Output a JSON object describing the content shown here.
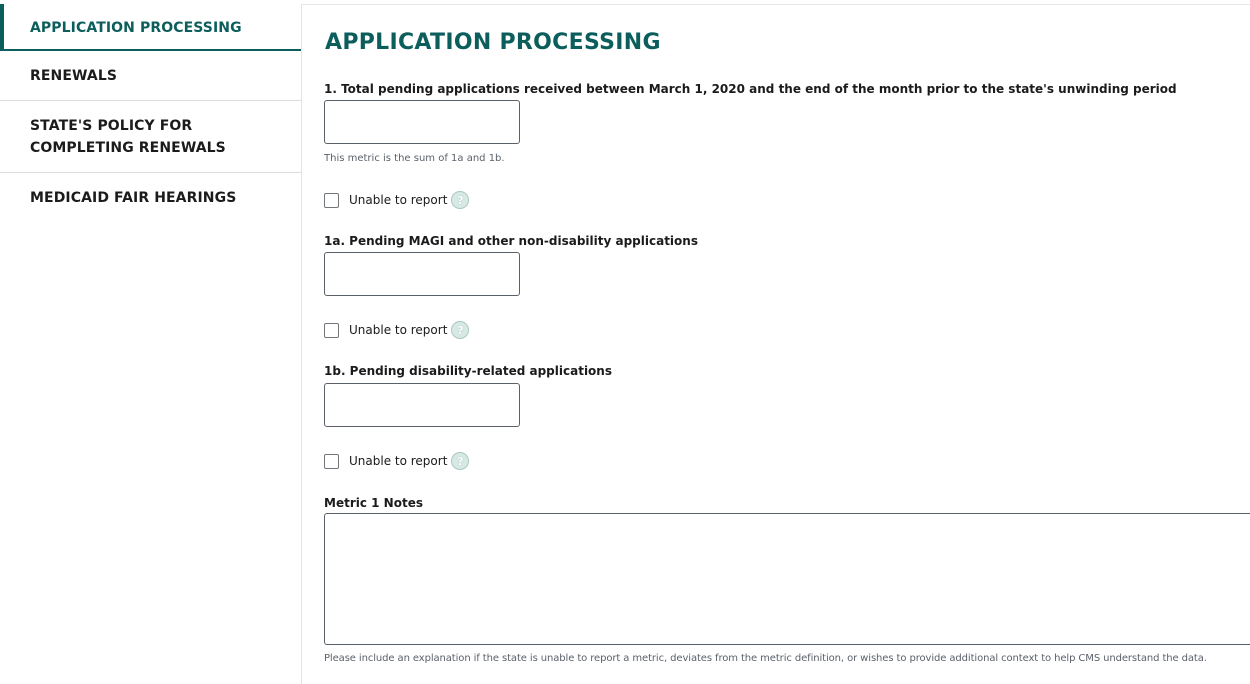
{
  "sidebar": {
    "items": [
      {
        "label": "APPLICATION PROCESSING",
        "active": true
      },
      {
        "label": "RENEWALS",
        "active": false
      },
      {
        "label": "STATE'S POLICY FOR COMPLETING RENEWALS",
        "active": false
      },
      {
        "label": "MEDICAID FAIR HEARINGS",
        "active": false
      }
    ]
  },
  "main": {
    "title": "APPLICATION PROCESSING",
    "q1": {
      "label": "1. Total pending applications received between March 1, 2020 and the end of the month prior to the state's unwinding period",
      "value": "",
      "hint": "This metric is the sum of 1a and 1b.",
      "unable_label": "Unable to report"
    },
    "q1a": {
      "label": "1a. Pending MAGI and other non-disability applications",
      "value": "",
      "unable_label": "Unable to report"
    },
    "q1b": {
      "label": "1b. Pending disability-related applications",
      "value": "",
      "unable_label": "Unable to report"
    },
    "notes": {
      "label": "Metric 1 Notes",
      "value": "",
      "hint": "Please include an explanation if the state is unable to report a metric, deviates from the metric definition, or wishes to provide additional context to help CMS understand the data."
    },
    "help_glyph": "?"
  },
  "colors": {
    "accent": "#0c5e5c",
    "help_bg": "#d6e9e4",
    "border": "#5b616b"
  },
  "icons": {
    "help": "question-circle-icon",
    "checkbox": "checkbox-unchecked"
  }
}
